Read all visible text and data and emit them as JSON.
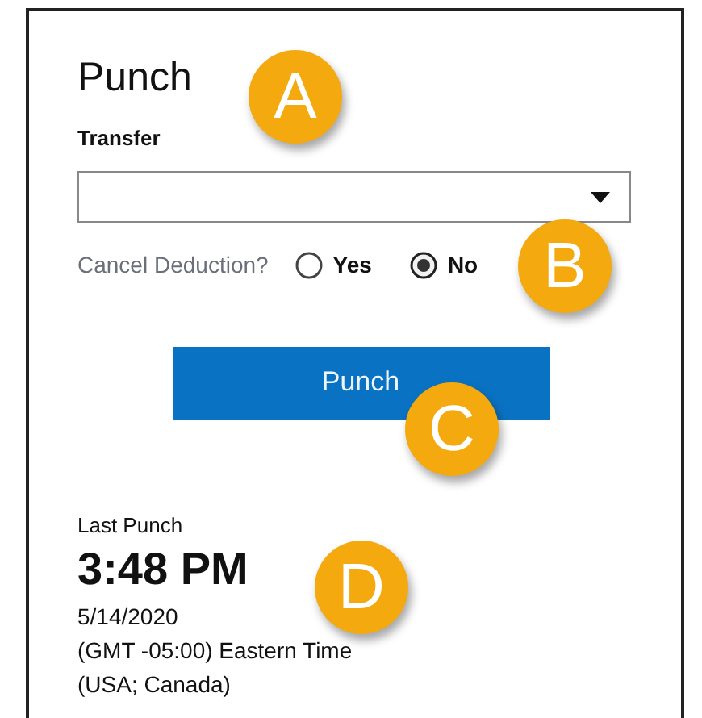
{
  "title": "Punch",
  "transfer": {
    "label": "Transfer"
  },
  "cancel_deduction": {
    "label": "Cancel Deduction?",
    "options": [
      {
        "label": "Yes",
        "selected": false
      },
      {
        "label": "No",
        "selected": true
      }
    ]
  },
  "punch_button": "Punch",
  "last_punch": {
    "label": "Last Punch",
    "time": "3:48 PM",
    "date": "5/14/2020",
    "timezone": "(GMT -05:00) Eastern Time (USA; Canada)"
  },
  "callouts": [
    "A",
    "B",
    "C",
    "D"
  ]
}
